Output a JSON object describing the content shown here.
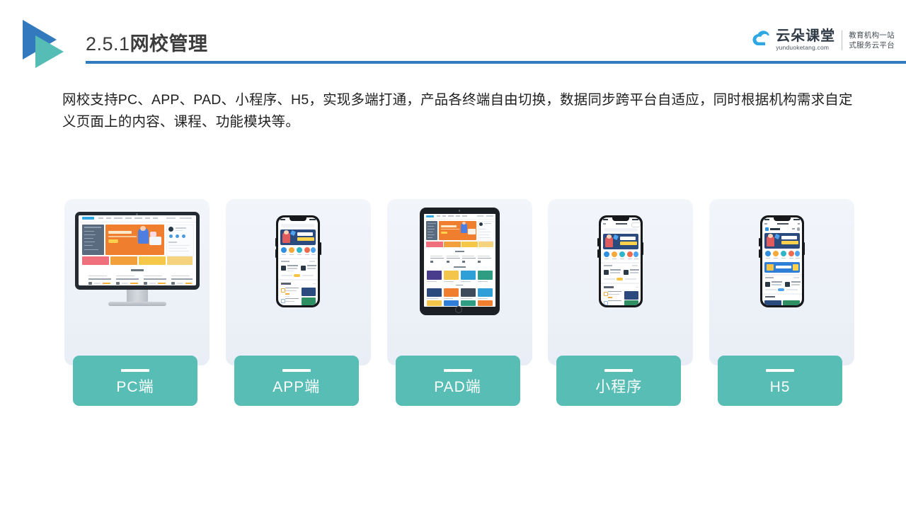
{
  "header": {
    "title_number": "2.5.1",
    "title_name": "网校管理",
    "rule_color": "#3279bd",
    "logo_colors": {
      "blue": "#3279bd",
      "teal": "#55bdb5"
    }
  },
  "brand": {
    "icon": "cloud-icon",
    "name_cn": "云朵课堂",
    "name_en": "yunduoketang.com",
    "tagline_line1": "教育机构一站",
    "tagline_line2": "式服务云平台"
  },
  "intro": {
    "line1": "网校支持PC、APP、PAD、小程序、H5，实现多端打通，产品各终端自由切换，数据同步跨平台自适应，同时根据机构",
    "line2": "需求自定义页面上的内容、课程、功能模块等。"
  },
  "cards": [
    {
      "id": "pc",
      "label": "PC端",
      "device": "monitor",
      "accent": "#57bdb5"
    },
    {
      "id": "app",
      "label": "APP端",
      "device": "phone",
      "accent": "#57bdb5"
    },
    {
      "id": "pad",
      "label": "PAD端",
      "device": "tablet",
      "accent": "#57bdb5"
    },
    {
      "id": "mini",
      "label": "小程序",
      "device": "phone",
      "accent": "#57bdb5"
    },
    {
      "id": "h5",
      "label": "H5",
      "device": "phone",
      "accent": "#57bdb5"
    }
  ],
  "theme": {
    "card_bg_top": "#f2f5fa",
    "card_bg_bottom": "#e9eef6",
    "teal": "#57bdb5",
    "blue": "#3279bd",
    "text_dark": "#1f1f1f"
  }
}
